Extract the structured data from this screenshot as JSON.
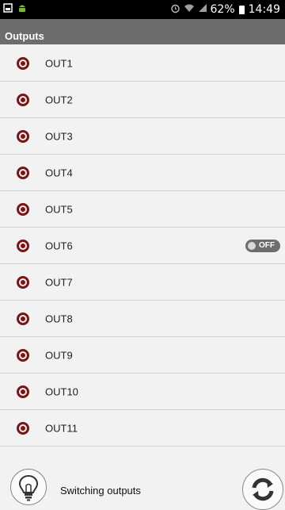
{
  "status_bar": {
    "battery": "62%",
    "time": "14:49",
    "icons": [
      "screenshot-icon",
      "android-icon",
      "alarm-icon",
      "wifi-icon",
      "signal-icon",
      "battery-icon"
    ]
  },
  "header": {
    "title": "Outputs"
  },
  "outputs": [
    {
      "label": "OUT1",
      "toggle": null
    },
    {
      "label": "OUT2",
      "toggle": null
    },
    {
      "label": "OUT3",
      "toggle": null
    },
    {
      "label": "OUT4",
      "toggle": null
    },
    {
      "label": "OUT5",
      "toggle": null
    },
    {
      "label": "OUT6",
      "toggle": "OFF"
    },
    {
      "label": "OUT7",
      "toggle": null
    },
    {
      "label": "OUT8",
      "toggle": null
    },
    {
      "label": "OUT9",
      "toggle": null
    },
    {
      "label": "OUT10",
      "toggle": null
    },
    {
      "label": "OUT11",
      "toggle": null
    }
  ],
  "bottom": {
    "label": "Switching outputs",
    "icons": [
      "lightbulb-icon",
      "refresh-icon"
    ]
  },
  "colors": {
    "radio": "#7a1515",
    "header_bg": "#6c6c6c",
    "toggle_bg": "#6d6d6d"
  }
}
